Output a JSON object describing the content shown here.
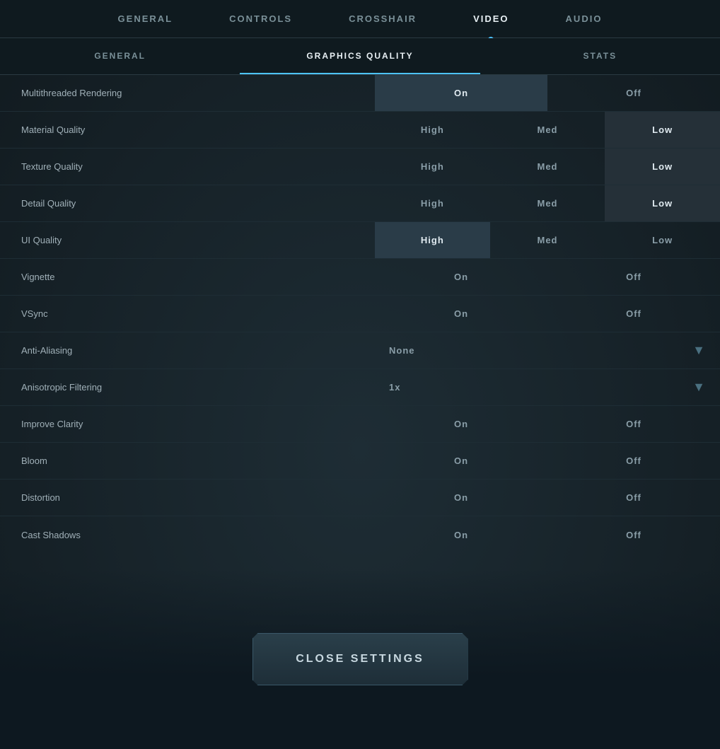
{
  "nav": {
    "tabs": [
      {
        "id": "general",
        "label": "GENERAL",
        "active": false
      },
      {
        "id": "controls",
        "label": "CONTROLS",
        "active": false
      },
      {
        "id": "crosshair",
        "label": "CROSSHAIR",
        "active": false
      },
      {
        "id": "video",
        "label": "VIDEO",
        "active": true
      },
      {
        "id": "audio",
        "label": "AUDIO",
        "active": false
      }
    ],
    "subtabs": [
      {
        "id": "general",
        "label": "GENERAL",
        "active": false
      },
      {
        "id": "graphics",
        "label": "GRAPHICS QUALITY",
        "active": true
      },
      {
        "id": "stats",
        "label": "STATS",
        "active": false
      }
    ]
  },
  "settings": [
    {
      "id": "multithreaded-rendering",
      "label": "Multithreaded Rendering",
      "type": "toggle",
      "selected": "On",
      "options": [
        "On",
        "Off"
      ]
    },
    {
      "id": "material-quality",
      "label": "Material Quality",
      "type": "three",
      "selected": "Low",
      "options": [
        "High",
        "Med",
        "Low"
      ]
    },
    {
      "id": "texture-quality",
      "label": "Texture Quality",
      "type": "three",
      "selected": "Low",
      "options": [
        "High",
        "Med",
        "Low"
      ]
    },
    {
      "id": "detail-quality",
      "label": "Detail Quality",
      "type": "three",
      "selected": "Low",
      "options": [
        "High",
        "Med",
        "Low"
      ]
    },
    {
      "id": "ui-quality",
      "label": "UI Quality",
      "type": "three",
      "selected": "High",
      "options": [
        "High",
        "Med",
        "Low"
      ]
    },
    {
      "id": "vignette",
      "label": "Vignette",
      "type": "toggle",
      "selected": "Off",
      "options": [
        "On",
        "Off"
      ]
    },
    {
      "id": "vsync",
      "label": "VSync",
      "type": "toggle",
      "selected": "Off",
      "options": [
        "On",
        "Off"
      ]
    },
    {
      "id": "anti-aliasing",
      "label": "Anti-Aliasing",
      "type": "dropdown",
      "selected": "None"
    },
    {
      "id": "anisotropic-filtering",
      "label": "Anisotropic Filtering",
      "type": "dropdown",
      "selected": "1x"
    },
    {
      "id": "improve-clarity",
      "label": "Improve Clarity",
      "type": "toggle",
      "selected": "Off",
      "options": [
        "On",
        "Off"
      ]
    },
    {
      "id": "bloom",
      "label": "Bloom",
      "type": "toggle",
      "selected": "Off",
      "options": [
        "On",
        "Off"
      ]
    },
    {
      "id": "distortion",
      "label": "Distortion",
      "type": "toggle",
      "selected": "Off",
      "options": [
        "On",
        "Off"
      ]
    },
    {
      "id": "cast-shadows",
      "label": "Cast Shadows",
      "type": "toggle",
      "selected": "Off",
      "options": [
        "On",
        "Off"
      ]
    }
  ],
  "close_button": {
    "label": "CLOSE SETTINGS"
  }
}
